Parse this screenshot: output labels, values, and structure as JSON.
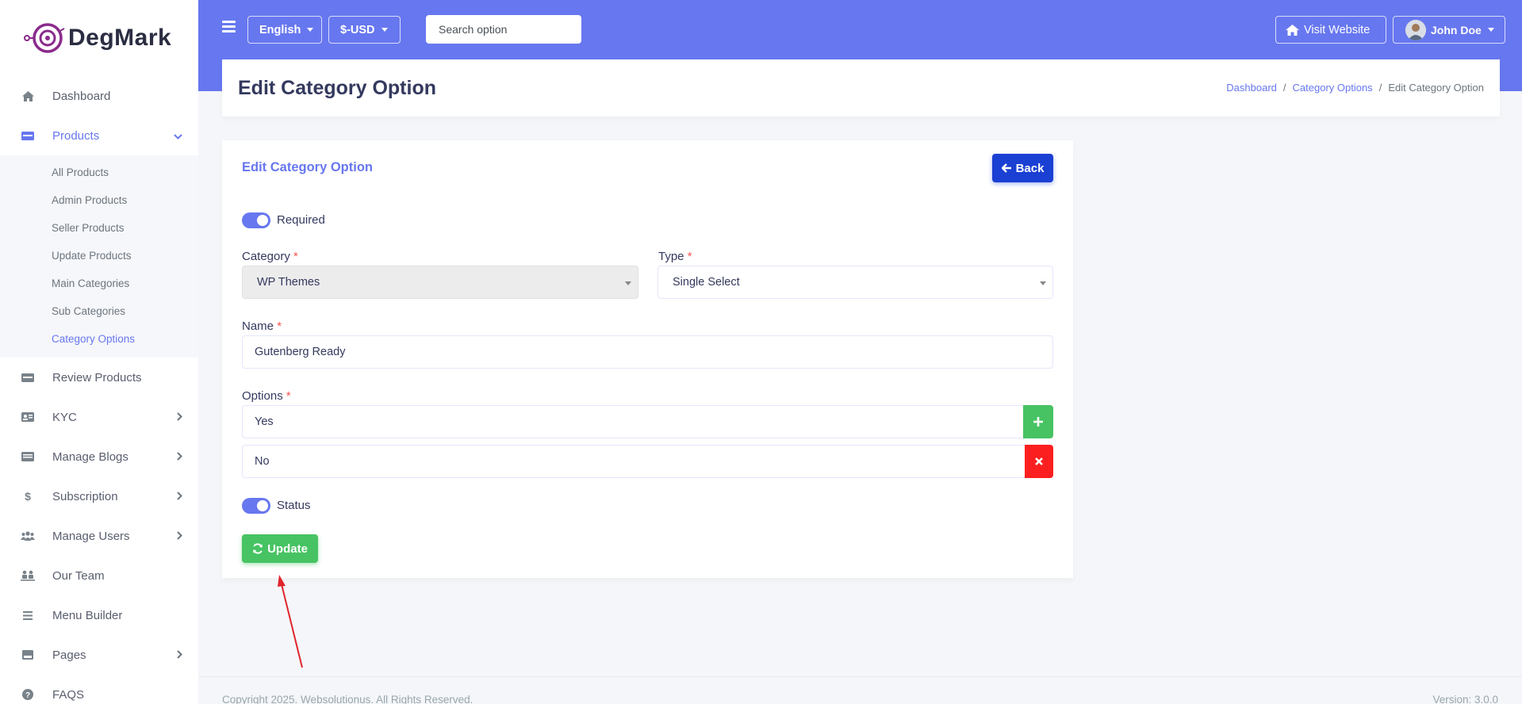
{
  "brand": {
    "name": "DegMark",
    "accent": "#6777ef"
  },
  "sidebar": {
    "items": [
      {
        "label": "Dashboard",
        "icon": "home-icon"
      },
      {
        "label": "Products",
        "icon": "products-icon",
        "active": true,
        "expanded": true,
        "children": [
          {
            "label": "All Products"
          },
          {
            "label": "Admin Products"
          },
          {
            "label": "Seller Products"
          },
          {
            "label": "Update Products"
          },
          {
            "label": "Main Categories"
          },
          {
            "label": "Sub Categories"
          },
          {
            "label": "Category Options",
            "active": true
          }
        ]
      },
      {
        "label": "Review Products",
        "icon": "review-icon"
      },
      {
        "label": "KYC",
        "icon": "id-card-icon"
      },
      {
        "label": "Manage Blogs",
        "icon": "blog-icon"
      },
      {
        "label": "Subscription",
        "icon": "dollar-icon"
      },
      {
        "label": "Manage Users",
        "icon": "users-icon"
      },
      {
        "label": "Our Team",
        "icon": "team-icon"
      },
      {
        "label": "Menu Builder",
        "icon": "list-icon"
      },
      {
        "label": "Pages",
        "icon": "pages-icon"
      },
      {
        "label": "FAQS",
        "icon": "question-icon"
      }
    ]
  },
  "topbar": {
    "language": "English",
    "currency": "$-USD",
    "search_placeholder": "Search option",
    "visit_website": "Visit Website",
    "user_name": "John Doe"
  },
  "header": {
    "title": "Edit Category Option",
    "breadcrumb": [
      "Dashboard",
      "Category Options",
      "Edit Category Option"
    ]
  },
  "form": {
    "card_title": "Edit Category Option",
    "back_label": "Back",
    "required_label": "Required",
    "required_on": true,
    "category_label": "Category",
    "category_value": "WP Themes",
    "type_label": "Type",
    "type_value": "Single Select",
    "name_label": "Name",
    "name_value": "Gutenberg Ready",
    "options_label": "Options",
    "options": [
      "Yes",
      "No"
    ],
    "status_label": "Status",
    "status_on": true,
    "update_label": "Update",
    "required_mark": "*"
  },
  "footer": {
    "copyright": "Copyright 2025. Websolutionus. All Rights Reserved.",
    "version": "Version: 3.0.0"
  },
  "colors": {
    "primary": "#6777ef",
    "success": "#47c363",
    "danger": "#fc1f1f",
    "back": "#1a3fd3"
  }
}
